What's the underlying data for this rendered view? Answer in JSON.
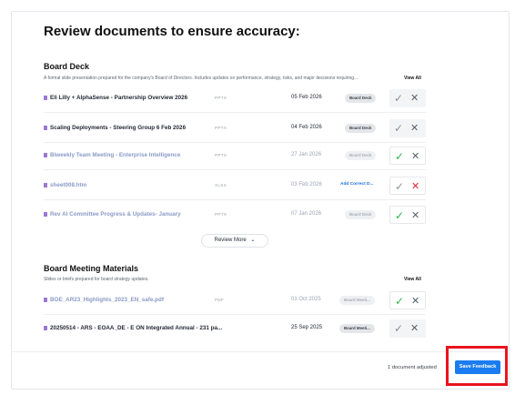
{
  "page": {
    "title": "Review documents to ensure accuracy:",
    "review_more_label": "Review More",
    "status_text": "1 document adjusted",
    "save_label": "Save Feedback"
  },
  "sections": [
    {
      "title": "Board Deck",
      "description": "A formal slide presentation prepared for the company's Board of Directors. Includes updates on performance, strategy, risks, and major decisions requiring...",
      "view_all": "View All",
      "rows": [
        {
          "name": "Eli Lilly + AlphaSense - Partnership Overview 2026",
          "type": "PPTX",
          "date": "05 Feb 2026",
          "badge": "Board Deck",
          "state": "pending"
        },
        {
          "name": "Scaling Deployments - Steering Group 6 Feb 2026",
          "type": "PPTX",
          "date": "04 Feb 2026",
          "badge": "Board Deck",
          "state": "pending"
        },
        {
          "name": "Biweekly Team Meeting - Enterprise Intelligence",
          "type": "PPTX",
          "date": "27 Jan 2026",
          "badge": "Board Deck",
          "state": "approved"
        },
        {
          "name": "sheet008.htm",
          "type": "XLSX",
          "date": "03 Feb 2026",
          "link": "Add Correct D...",
          "state": "rejected"
        },
        {
          "name": "Rev AI Committee Progress & Updates- January",
          "type": "PPTX",
          "date": "07 Jan 2026",
          "badge": "Board Deck",
          "state": "approved"
        }
      ]
    },
    {
      "title": "Board Meeting Materials",
      "description": "Slides or briefs prepared for board strategy updates.",
      "view_all": "View All",
      "rows": [
        {
          "name": "BOE_AR23_Highlights_2023_EN_safe.pdf",
          "type": "PDF",
          "date": "01 Oct 2025",
          "badge": "Board Meeti...",
          "state": "approved"
        },
        {
          "name": "20250514 - ARS - EOAA_DE - E ON Integrated Annual - 231 pa...",
          "type": "",
          "date": "25 Sep 2025",
          "badge": "Board Meeti...",
          "state": "pending"
        }
      ]
    }
  ],
  "icons": {
    "approve": "check-icon",
    "reject": "close-icon",
    "file": "document-icon",
    "chevron": "chevron-down-icon"
  },
  "colors": {
    "accent": "#1a7cf0",
    "approved": "#2db34a",
    "rejected": "#e0282e",
    "highlight": "#e8141e"
  }
}
